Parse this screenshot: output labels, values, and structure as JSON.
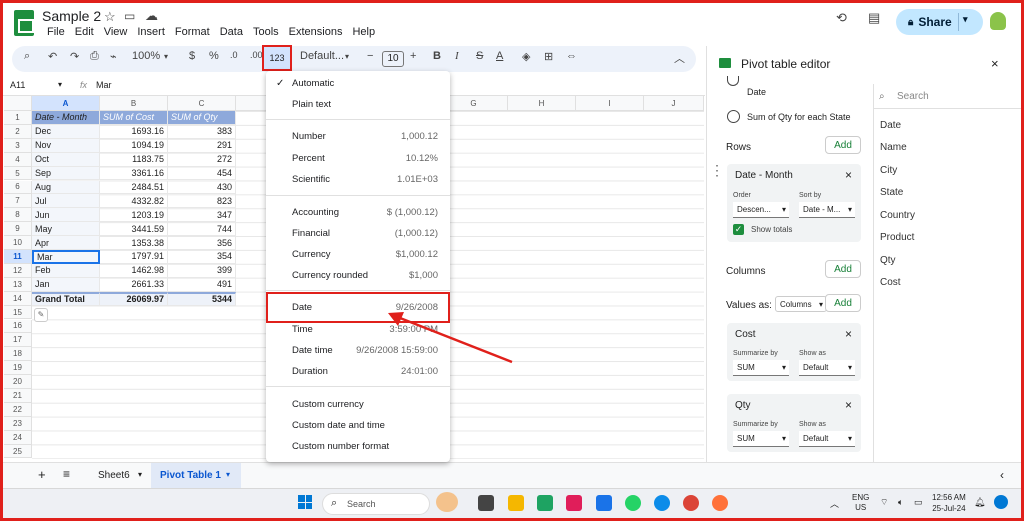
{
  "app": {
    "title": "Sample 2",
    "menu": [
      "File",
      "Edit",
      "View",
      "Insert",
      "Format",
      "Data",
      "Tools",
      "Extensions",
      "Help"
    ],
    "share_label": "Share"
  },
  "toolbar": {
    "zoom": "100%",
    "currency": "$",
    "percent": "%",
    "decrease_decimal": ".0",
    "increase_decimal": ".00",
    "more_formats": "123",
    "font": "Default...",
    "font_size": "10"
  },
  "formula": {
    "cell_ref": "A11",
    "fx": "fx",
    "value": "Mar"
  },
  "grid": {
    "columns": [
      "A",
      "B",
      "C",
      "D",
      "E",
      "F",
      "G",
      "H",
      "I",
      "J"
    ],
    "row_numbers": [
      "1",
      "2",
      "3",
      "4",
      "5",
      "6",
      "7",
      "8",
      "9",
      "10",
      "11",
      "12",
      "13",
      "14",
      "15",
      "16",
      "17",
      "18",
      "19",
      "20",
      "21",
      "22",
      "23",
      "24",
      "25"
    ],
    "header": [
      "Date - Month",
      "SUM of Cost",
      "SUM of Qty"
    ],
    "rows": [
      [
        "Dec",
        "1693.16",
        "383"
      ],
      [
        "Nov",
        "1094.19",
        "291"
      ],
      [
        "Oct",
        "1183.75",
        "272"
      ],
      [
        "Sep",
        "3361.16",
        "454"
      ],
      [
        "Aug",
        "2484.51",
        "430"
      ],
      [
        "Jul",
        "4332.82",
        "823"
      ],
      [
        "Jun",
        "1203.19",
        "347"
      ],
      [
        "May",
        "3441.59",
        "744"
      ],
      [
        "Apr",
        "1353.38",
        "356"
      ],
      [
        "Mar",
        "1797.91",
        "354"
      ],
      [
        "Feb",
        "1462.98",
        "399"
      ],
      [
        "Jan",
        "2661.33",
        "491"
      ]
    ],
    "total": [
      "Grand Total",
      "26069.97",
      "5344"
    ]
  },
  "format_menu": [
    {
      "label": "Automatic",
      "example": "",
      "checked": true
    },
    {
      "label": "Plain text",
      "example": ""
    },
    {
      "label": "Number",
      "example": "1,000.12"
    },
    {
      "label": "Percent",
      "example": "10.12%"
    },
    {
      "label": "Scientific",
      "example": "1.01E+03"
    },
    {
      "label": "Accounting",
      "example": "$ (1,000.12)"
    },
    {
      "label": "Financial",
      "example": "(1,000.12)"
    },
    {
      "label": "Currency",
      "example": "$1,000.12"
    },
    {
      "label": "Currency rounded",
      "example": "$1,000"
    },
    {
      "label": "Date",
      "example": "9/26/2008"
    },
    {
      "label": "Time",
      "example": "3:59:00 PM"
    },
    {
      "label": "Date time",
      "example": "9/26/2008 15:59:00"
    },
    {
      "label": "Duration",
      "example": "24:01:00"
    },
    {
      "label": "Custom currency",
      "example": ""
    },
    {
      "label": "Custom date and time",
      "example": ""
    },
    {
      "label": "Custom number format",
      "example": ""
    }
  ],
  "pivot_editor": {
    "title": "Pivot table editor",
    "partial_option": "Date",
    "radio_label": "Sum of Qty for each State",
    "rows_label": "Rows",
    "columns_label": "Columns",
    "values_label": "Values as:",
    "values_as": "Columns",
    "add": "Add",
    "row_card": {
      "title": "Date - Month",
      "order_label": "Order",
      "order_value": "Descen...",
      "sort_label": "Sort by",
      "sort_value": "Date - M...",
      "show_totals": "Show totals"
    },
    "value_cards": [
      {
        "title": "Cost",
        "summarize_label": "Summarize by",
        "summarize_value": "SUM",
        "show_label": "Show as",
        "show_value": "Default"
      },
      {
        "title": "Qty",
        "summarize_label": "Summarize by",
        "summarize_value": "SUM",
        "show_label": "Show as",
        "show_value": "Default"
      }
    ],
    "search_placeholder": "Search",
    "fields": [
      "Date",
      "Name",
      "City",
      "State",
      "Country",
      "Product",
      "Qty",
      "Cost"
    ]
  },
  "sheets": {
    "tabs": [
      "Sheet6",
      "Pivot Table 1"
    ],
    "active": "Pivot Table 1"
  },
  "taskbar": {
    "search": "Search",
    "lang": "ENG",
    "region": "US",
    "time": "12:56 AM",
    "date": "25-Jul-24"
  },
  "colors": {
    "accent_red": "#e0201b",
    "sheets_green": "#1e8e3e",
    "pivot_header": "#8ea9db"
  }
}
